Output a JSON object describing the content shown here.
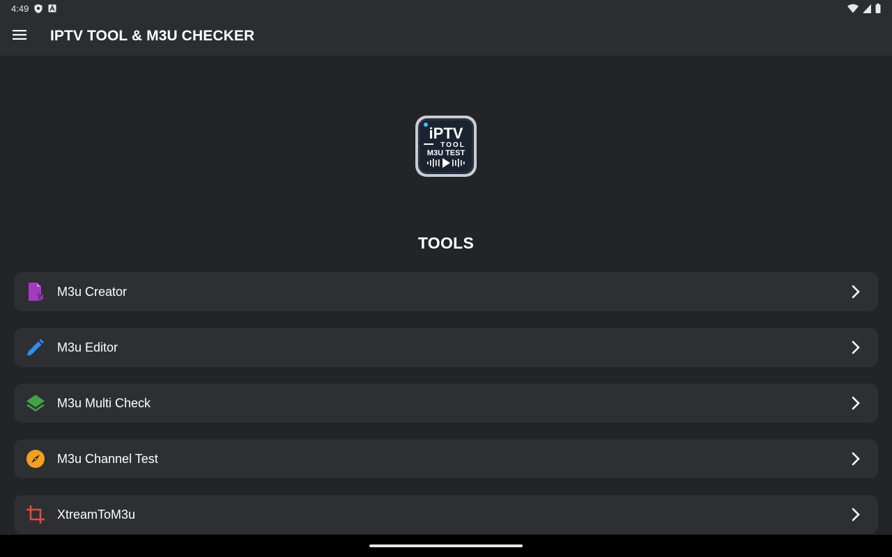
{
  "status_bar": {
    "time": "4:49",
    "left_icons": [
      "shield-icon",
      "a-notification-icon"
    ],
    "right_icons": [
      "wifi-icon",
      "signal-icon",
      "battery-icon"
    ]
  },
  "app_bar": {
    "menu_icon": "menu-icon",
    "title": "IPTV TOOL & M3U CHECKER"
  },
  "logo": {
    "line1": "iPTV",
    "line2": "TOOL",
    "line3": "M3U TEST"
  },
  "section": {
    "title": "TOOLS"
  },
  "tools": [
    {
      "label": "M3u Creator",
      "icon": "file-import-icon",
      "color": "#a43ac3"
    },
    {
      "label": "M3u Editor",
      "icon": "pencil-icon",
      "color": "#2f8ef0"
    },
    {
      "label": "M3u Multi Check",
      "icon": "layers-icon",
      "color": "#43a047"
    },
    {
      "label": "M3u Channel Test",
      "icon": "compass-icon",
      "color": "#f4a01c"
    },
    {
      "label": "XtreamToM3u",
      "icon": "crop-icon",
      "color": "#e84a3b"
    }
  ],
  "colors": {
    "background": "#222427",
    "app_bar": "#2b2d31",
    "card": "#2d2f33"
  }
}
